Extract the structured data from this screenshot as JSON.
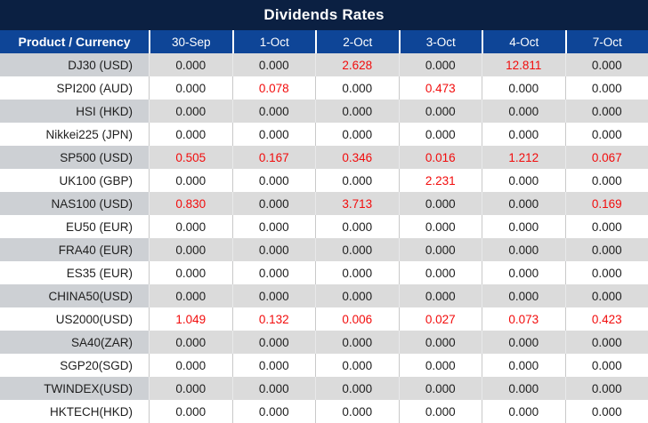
{
  "title": "Dividends Rates",
  "colors": {
    "title_bar_bg": "#0B2042",
    "header_bg": "#0E4597",
    "header_text": "#FFFFFF",
    "row_shade_product_bg": "#CDD0D4",
    "row_shade_value_bg": "#DBDBDB",
    "row_plain_bg": "#FFFFFF",
    "value_text": "#1E1E1E",
    "highlight_text": "#F20C0C",
    "separator_on_white": "#C9C9C9",
    "separator_on_gray": "#E8E9EA"
  },
  "table": {
    "product_header": "Product / Currency",
    "date_headers": [
      "30-Sep",
      "1-Oct",
      "2-Oct",
      "3-Oct",
      "4-Oct",
      "7-Oct"
    ],
    "zero_value": "0.000",
    "rows": [
      {
        "product": "DJ30 (USD)",
        "values": [
          "0.000",
          "0.000",
          "2.628",
          "0.000",
          "12.811",
          "0.000"
        ]
      },
      {
        "product": "SPI200 (AUD)",
        "values": [
          "0.000",
          "0.078",
          "0.000",
          "0.473",
          "0.000",
          "0.000"
        ]
      },
      {
        "product": "HSI (HKD)",
        "values": [
          "0.000",
          "0.000",
          "0.000",
          "0.000",
          "0.000",
          "0.000"
        ]
      },
      {
        "product": "Nikkei225 (JPN)",
        "values": [
          "0.000",
          "0.000",
          "0.000",
          "0.000",
          "0.000",
          "0.000"
        ]
      },
      {
        "product": "SP500 (USD)",
        "values": [
          "0.505",
          "0.167",
          "0.346",
          "0.016",
          "1.212",
          "0.067"
        ]
      },
      {
        "product": "UK100 (GBP)",
        "values": [
          "0.000",
          "0.000",
          "0.000",
          "2.231",
          "0.000",
          "0.000"
        ]
      },
      {
        "product": "NAS100 (USD)",
        "values": [
          "0.830",
          "0.000",
          "3.713",
          "0.000",
          "0.000",
          "0.169"
        ]
      },
      {
        "product": "EU50 (EUR)",
        "values": [
          "0.000",
          "0.000",
          "0.000",
          "0.000",
          "0.000",
          "0.000"
        ]
      },
      {
        "product": "FRA40 (EUR)",
        "values": [
          "0.000",
          "0.000",
          "0.000",
          "0.000",
          "0.000",
          "0.000"
        ]
      },
      {
        "product": "ES35 (EUR)",
        "values": [
          "0.000",
          "0.000",
          "0.000",
          "0.000",
          "0.000",
          "0.000"
        ]
      },
      {
        "product": "CHINA50(USD)",
        "values": [
          "0.000",
          "0.000",
          "0.000",
          "0.000",
          "0.000",
          "0.000"
        ]
      },
      {
        "product": "US2000(USD)",
        "values": [
          "1.049",
          "0.132",
          "0.006",
          "0.027",
          "0.073",
          "0.423"
        ]
      },
      {
        "product": "SA40(ZAR)",
        "values": [
          "0.000",
          "0.000",
          "0.000",
          "0.000",
          "0.000",
          "0.000"
        ]
      },
      {
        "product": "SGP20(SGD)",
        "values": [
          "0.000",
          "0.000",
          "0.000",
          "0.000",
          "0.000",
          "0.000"
        ]
      },
      {
        "product": "TWINDEX(USD)",
        "values": [
          "0.000",
          "0.000",
          "0.000",
          "0.000",
          "0.000",
          "0.000"
        ]
      },
      {
        "product": "HKTECH(HKD)",
        "values": [
          "0.000",
          "0.000",
          "0.000",
          "0.000",
          "0.000",
          "0.000"
        ]
      }
    ]
  }
}
